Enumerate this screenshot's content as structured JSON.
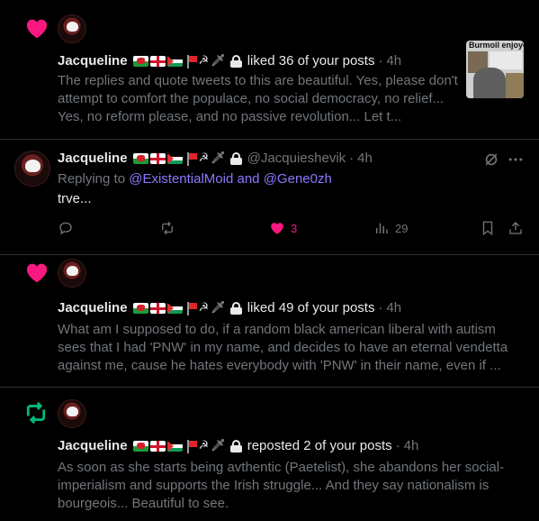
{
  "notifications": [
    {
      "type": "like",
      "user": "Jacqueline",
      "action": "liked 36 of your posts",
      "time": "4h",
      "text": "The replies and quote tweets to this are beautiful. Yes, please don't attempt to comfort the populace, no social democracy, no relief... Yes, no reform please, and no passive revolution... Let t...",
      "thumb_caption": "Burmoil enjoyers"
    },
    {
      "type": "reply",
      "user": "Jacqueline",
      "handle": "@Jacquieshevik",
      "time": "4h",
      "replying_prefix": "Replying to",
      "mention1": "@ExistentialMoid",
      "and": "and",
      "mention2": "@Gene0zh",
      "text": "trve...",
      "likes": "3",
      "views": "29"
    },
    {
      "type": "like",
      "user": "Jacqueline",
      "action": "liked 49 of your posts",
      "time": "4h",
      "text": "What am I supposed to do, if a random black american liberal with autism sees that I had 'PNW' in my name, and decides to have an eternal vendetta against me, cause he hates everybody with 'PNW' in their name, even if ..."
    },
    {
      "type": "repost",
      "user": "Jacqueline",
      "action": "reposted 2 of your posts",
      "time": "4h",
      "text": "As soon as she starts being avthentic (Paetelist), she abandons her social-imperialism and supports the Irish struggle... And they say nationalism is bourgeois... Beautiful to see."
    }
  ],
  "emoji_names": [
    "wales-flag",
    "england-flag",
    "palestine-flag",
    "red-flag",
    "hammer-sickle",
    "dagger",
    "lock"
  ],
  "colors": {
    "like": "#f91880",
    "repost": "#00ba7c",
    "mention": "#8b78ff",
    "dim": "#71767b",
    "text": "#e7e9ea",
    "separator": "#2f3336"
  }
}
